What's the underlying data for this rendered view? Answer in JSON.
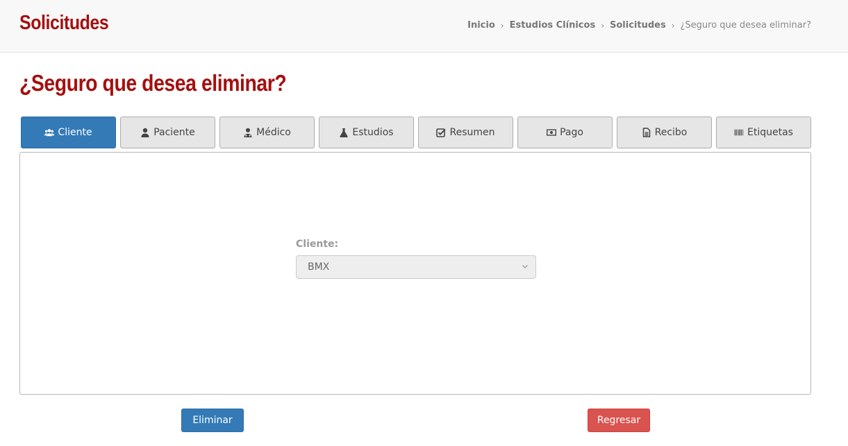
{
  "header": {
    "app_title": "Solicitudes",
    "breadcrumb": [
      {
        "label": "Inicio"
      },
      {
        "label": "Estudios Clínicos"
      },
      {
        "label": "Solicitudes"
      },
      {
        "label": "¿Seguro que desea eliminar?"
      }
    ]
  },
  "page": {
    "title": "¿Seguro que desea eliminar?"
  },
  "tabs": [
    {
      "label": "Cliente",
      "icon": "users-icon",
      "active": true
    },
    {
      "label": "Paciente",
      "icon": "user-icon",
      "active": false
    },
    {
      "label": "Médico",
      "icon": "doctor-icon",
      "active": false
    },
    {
      "label": "Estudios",
      "icon": "flask-icon",
      "active": false
    },
    {
      "label": "Resumen",
      "icon": "check-square-icon",
      "active": false
    },
    {
      "label": "Pago",
      "icon": "money-icon",
      "active": false
    },
    {
      "label": "Recibo",
      "icon": "file-text-icon",
      "active": false
    },
    {
      "label": "Etiquetas",
      "icon": "barcode-icon",
      "active": false
    }
  ],
  "form": {
    "cliente_label": "Cliente:",
    "cliente_value": "BMX"
  },
  "actions": {
    "delete_label": "Eliminar",
    "back_label": "Regresar"
  },
  "colors": {
    "brand_red": "#a50f0f",
    "primary": "#337ab7",
    "danger": "#d9534f"
  }
}
